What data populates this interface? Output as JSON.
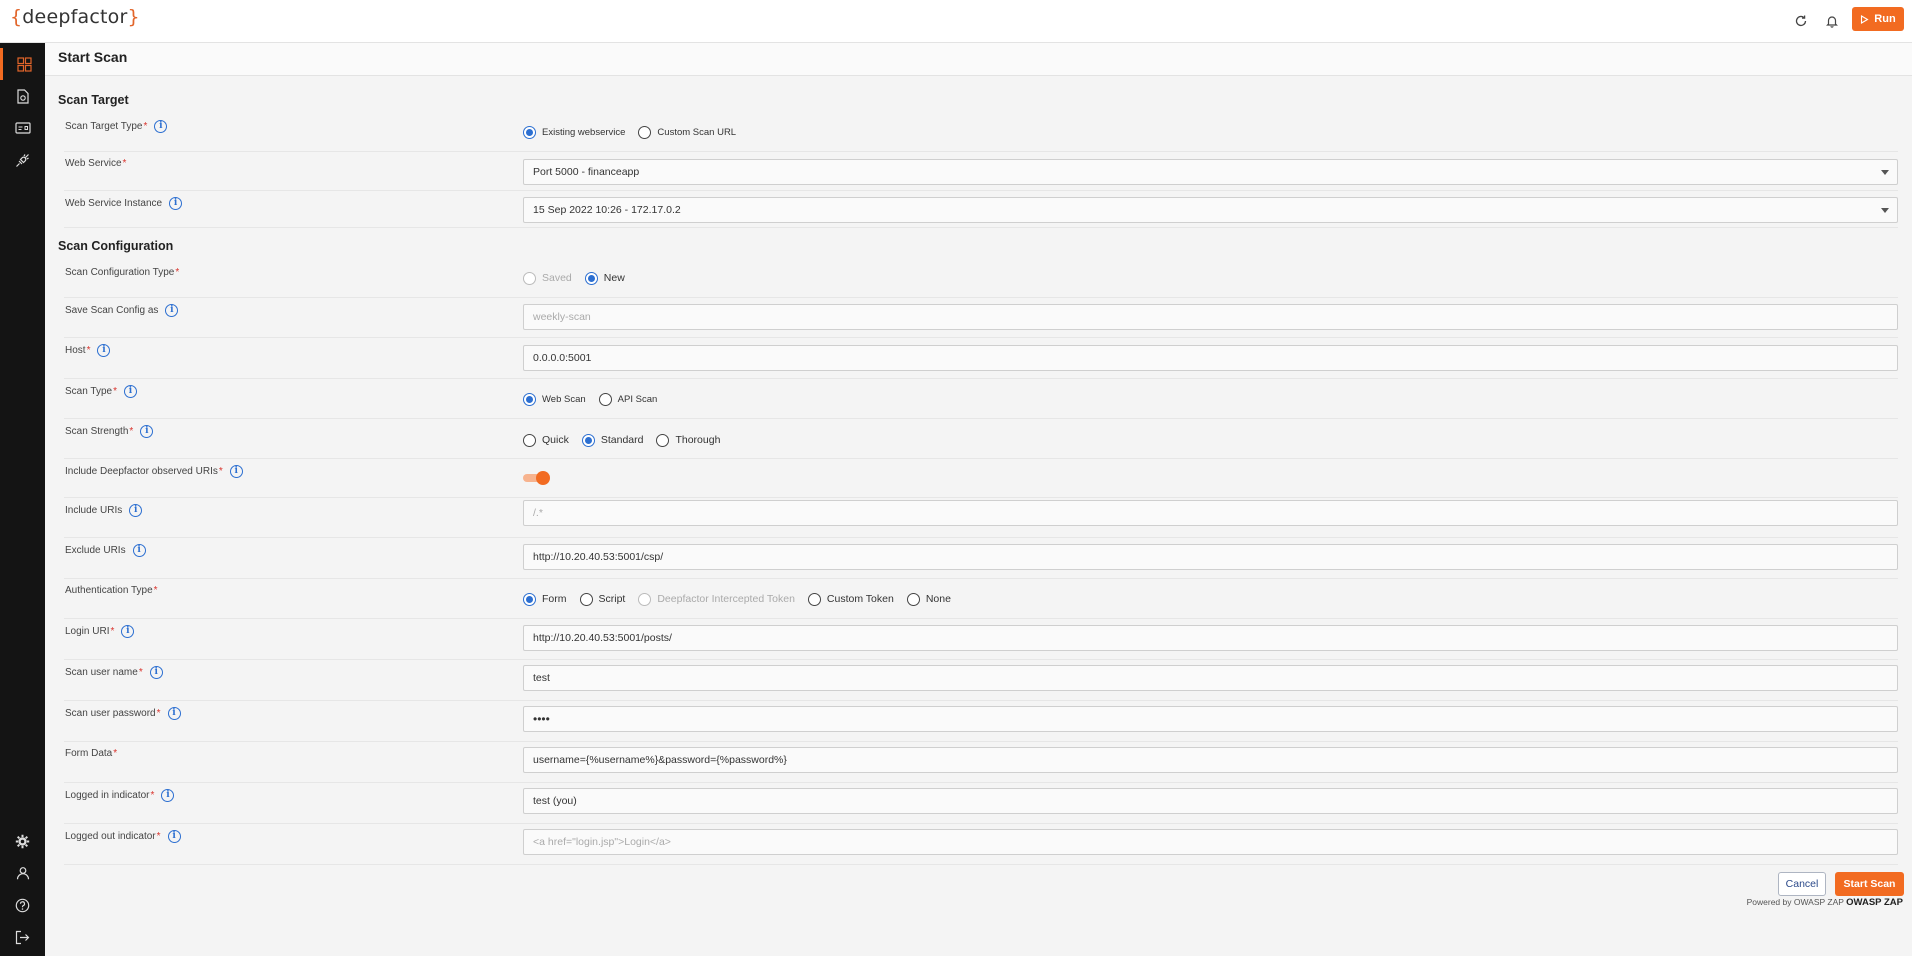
{
  "app": {
    "logo_left": "{",
    "logo_name": "deepfactor",
    "logo_right": "}",
    "run_label": "Run"
  },
  "page": {
    "title": "Start Scan"
  },
  "sections": {
    "target": "Scan Target",
    "config": "Scan Configuration"
  },
  "fields": {
    "scan_target_type": {
      "label": "Scan Target Type",
      "options": [
        "Existing webservice",
        "Custom Scan URL"
      ],
      "selected": "Existing webservice"
    },
    "web_service": {
      "label": "Web Service",
      "value": "Port 5000 - financeapp"
    },
    "web_service_instance": {
      "label": "Web Service Instance",
      "value": "15 Sep 2022 10:26 - 172.17.0.2"
    },
    "scan_config_type": {
      "label": "Scan Configuration Type",
      "options": [
        "Saved",
        "New"
      ],
      "selected": "New"
    },
    "save_config_as": {
      "label": "Save Scan Config as",
      "placeholder": "weekly-scan"
    },
    "host": {
      "label": "Host",
      "value": "0.0.0.0:5001"
    },
    "scan_type": {
      "label": "Scan Type",
      "options": [
        "Web Scan",
        "API Scan"
      ],
      "selected": "Web Scan"
    },
    "scan_strength": {
      "label": "Scan Strength",
      "options": [
        "Quick",
        "Standard",
        "Thorough"
      ],
      "selected": "Standard"
    },
    "include_observed": {
      "label": "Include Deepfactor observed URIs",
      "enabled": true
    },
    "include_uris": {
      "label": "Include URIs",
      "placeholder": "/.*"
    },
    "exclude_uris": {
      "label": "Exclude URIs",
      "value": "http://10.20.40.53:5001/csp/"
    },
    "auth_type": {
      "label": "Authentication Type",
      "options": [
        "Form",
        "Script",
        "Deepfactor Intercepted Token",
        "Custom Token",
        "None"
      ],
      "selected": "Form"
    },
    "login_uri": {
      "label": "Login URI",
      "value": "http://10.20.40.53:5001/posts/"
    },
    "username": {
      "label": "Scan user name",
      "value": "test"
    },
    "password": {
      "label": "Scan user password",
      "value": "••••"
    },
    "form_data": {
      "label": "Form Data",
      "value": "username={%username%}&password={%password%}"
    },
    "logged_in": {
      "label": "Logged in indicator",
      "value": "test (you)"
    },
    "logged_out": {
      "label": "Logged out indicator",
      "placeholder": "<a href=\"login.jsp\">Login</a>"
    }
  },
  "actions": {
    "cancel": "Cancel",
    "start": "Start Scan"
  },
  "footer": {
    "powered_prefix": "Powered by OWASP ZAP",
    "powered_brand": "OWASP ZAP"
  },
  "icons": {
    "sidebar": [
      "dashboard-icon",
      "report-icon",
      "id-card-icon",
      "plug-icon",
      "gear-icon",
      "user-icon",
      "help-icon",
      "logout-icon"
    ],
    "top": [
      "refresh-icon",
      "bell-icon",
      "play-icon"
    ]
  },
  "colors": {
    "accent": "#f26b21",
    "primary": "#2c6fd1",
    "sidebar": "#141414",
    "required": "#d9322b"
  }
}
